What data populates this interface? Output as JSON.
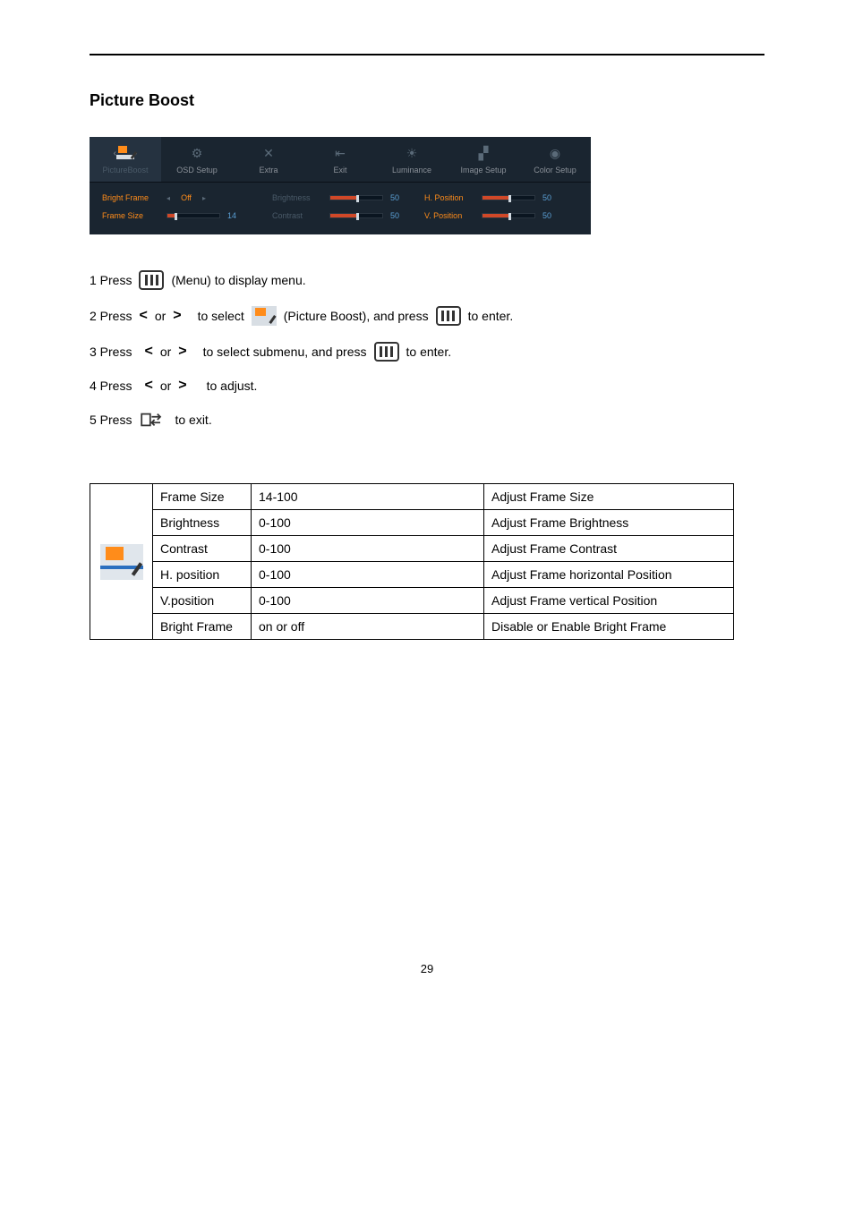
{
  "section_title": "Picture Boost",
  "page_number": "29",
  "osd": {
    "tabs": [
      {
        "label": "PictureBoost"
      },
      {
        "label": "OSD Setup"
      },
      {
        "label": "Extra"
      },
      {
        "label": "Exit"
      },
      {
        "label": "Luminance"
      },
      {
        "label": "Image Setup"
      },
      {
        "label": "Color Setup"
      }
    ],
    "left": [
      {
        "label": "Bright Frame",
        "value": "Off"
      },
      {
        "label": "Frame Size",
        "value": "14",
        "fill": 14
      }
    ],
    "mid": [
      {
        "label": "Brightness",
        "value": "50",
        "fill": 50
      },
      {
        "label": "Contrast",
        "value": "50",
        "fill": 50
      }
    ],
    "right": [
      {
        "label": "H. Position",
        "value": "50",
        "fill": 50
      },
      {
        "label": "V. Position",
        "value": "50",
        "fill": 50
      }
    ]
  },
  "steps": {
    "s1a": "1 Press",
    "s1b": "(Menu) to display menu.",
    "s2a": "2 Press",
    "s2b": "or",
    "s2c": "to select",
    "s2d": "(Picture Boost), and press",
    "s2e": "to enter.",
    "s3a": "3 Press",
    "s3b": "or",
    "s3c": "to select submenu, and press",
    "s3d": "to enter.",
    "s4a": "4 Press",
    "s4b": "or",
    "s4c": "to adjust.",
    "s5a": "5 Press",
    "s5b": "to exit."
  },
  "table": [
    {
      "name": "Frame Size",
      "range": "14-100",
      "desc": "Adjust Frame Size"
    },
    {
      "name": "Brightness",
      "range": "0-100",
      "desc": "Adjust Frame Brightness"
    },
    {
      "name": "Contrast",
      "range": "0-100",
      "desc": "Adjust Frame Contrast"
    },
    {
      "name": "H. position",
      "range": "0-100",
      "desc": "Adjust Frame horizontal Position"
    },
    {
      "name": "V.position",
      "range": "0-100",
      "desc": "Adjust Frame vertical Position"
    },
    {
      "name": "Bright Frame",
      "range": "on or off",
      "desc": "Disable or Enable Bright Frame"
    }
  ]
}
